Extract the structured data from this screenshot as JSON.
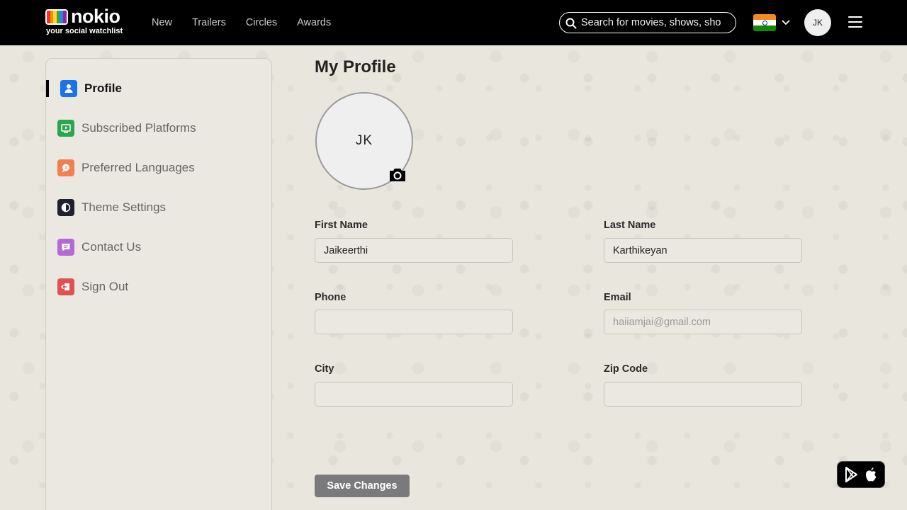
{
  "brand": {
    "name": "nokio",
    "tagline": "your social watchlist"
  },
  "nav": {
    "items": [
      "New",
      "Trailers",
      "Circles",
      "Awards"
    ]
  },
  "search": {
    "placeholder": "Search for movies, shows, sho"
  },
  "user": {
    "initials": "JK"
  },
  "sidebar": {
    "items": [
      {
        "label": "Profile",
        "icon": "user-icon",
        "color": "#1a73e8",
        "active": true
      },
      {
        "label": "Subscribed Platforms",
        "icon": "tv-play-icon",
        "color": "#2ea44f"
      },
      {
        "label": "Preferred Languages",
        "icon": "language-icon",
        "color": "#f47e4e"
      },
      {
        "label": "Theme Settings",
        "icon": "theme-icon",
        "color": "#1f1f2e"
      },
      {
        "label": "Contact Us",
        "icon": "chat-icon",
        "color": "#b36ad4"
      },
      {
        "label": "Sign Out",
        "icon": "sign-out-icon",
        "color": "#e05252"
      }
    ]
  },
  "profile": {
    "title": "My Profile",
    "avatar_initials": "JK",
    "fields": {
      "first_name": {
        "label": "First Name",
        "value": "Jaikeerthi"
      },
      "last_name": {
        "label": "Last Name",
        "value": "Karthikeyan"
      },
      "phone": {
        "label": "Phone",
        "value": ""
      },
      "email": {
        "label": "Email",
        "value": "",
        "placeholder": "haiiamjai@gmail.com"
      },
      "city": {
        "label": "City",
        "value": ""
      },
      "zip": {
        "label": "Zip Code",
        "value": ""
      }
    },
    "save_label": "Save Changes"
  }
}
